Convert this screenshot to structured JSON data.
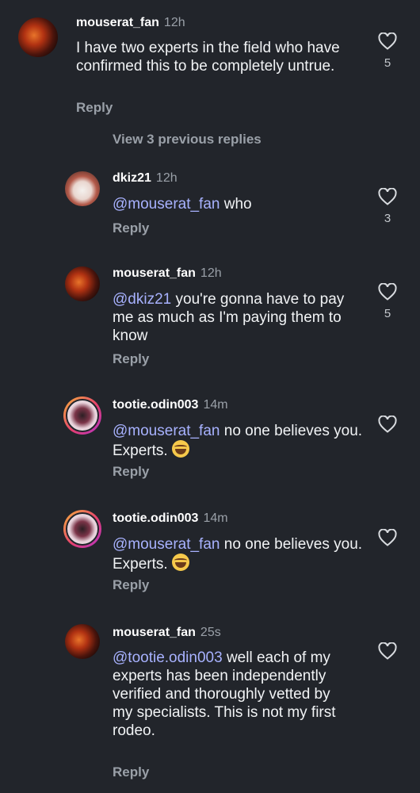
{
  "comments": [
    {
      "username": "mouserat_fan",
      "time": "12h",
      "mention": "",
      "text": "I have two experts in the field who have confirmed this to be completely untrue.",
      "reply_label": "Reply",
      "likes": "5"
    },
    {
      "username": "dkiz21",
      "time": "12h",
      "mention": "@mouserat_fan",
      "text": " who",
      "reply_label": "Reply",
      "likes": "3"
    },
    {
      "username": "mouserat_fan",
      "time": "12h",
      "mention": "@dkiz21",
      "text": " you're gonna have to pay me as much as I'm paying them to know",
      "reply_label": "Reply",
      "likes": "5"
    },
    {
      "username": "tootie.odin003",
      "time": "14m",
      "mention": "@mouserat_fan",
      "text": " no one believes you. Experts. ",
      "emoji": "joy-emoji",
      "reply_label": "Reply",
      "likes": ""
    },
    {
      "username": "tootie.odin003",
      "time": "14m",
      "mention": "@mouserat_fan",
      "text": " no one believes you. Experts. ",
      "emoji": "joy-emoji",
      "reply_label": "Reply",
      "likes": ""
    },
    {
      "username": "mouserat_fan",
      "time": "25s",
      "mention": "@tootie.odin003",
      "text": " well each of my experts has been independently verified and thoroughly vetted by my specialists. This is not my first rodeo.",
      "reply_label": "Reply",
      "likes": ""
    }
  ],
  "view_previous": "View 3 previous replies",
  "colors": {
    "background": "#22252b",
    "mention": "#a8b2ff",
    "muted": "#9aa0a8"
  },
  "icons": {
    "like": "heart-outline-icon"
  }
}
